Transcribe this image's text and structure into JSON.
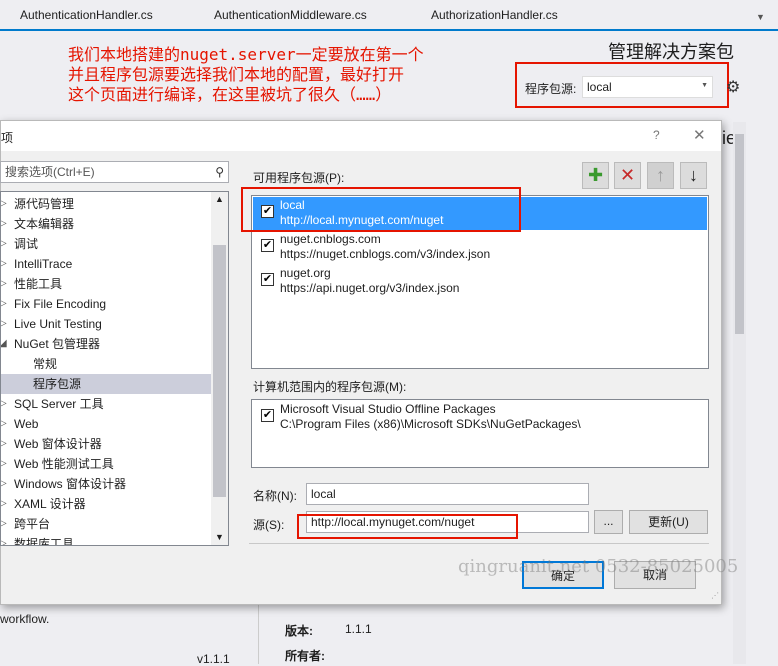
{
  "tabs": [
    "AuthenticationHandler.cs",
    "AuthenticationMiddleware.cs",
    "AuthorizationHandler.cs"
  ],
  "annotation": "我们本地搭建的nuget.server一定要放在第一个\n并且程序包源要选择我们本地的配置，最好打开\n这个页面进行编译，在这里被坑了很久（……）",
  "manager": {
    "title": "管理解决方案包",
    "source_label": "程序包源:",
    "source_value": "local",
    "partial_heading": "ie:"
  },
  "dialog": {
    "title": "项",
    "help": "?",
    "close": "✕",
    "search_placeholder": "搜索选项(Ctrl+E)",
    "tree": [
      {
        "label": "源代码管理",
        "arrow": "▷"
      },
      {
        "label": "文本编辑器",
        "arrow": "▷"
      },
      {
        "label": "调试",
        "arrow": "▷"
      },
      {
        "label": "IntelliTrace",
        "arrow": "▷"
      },
      {
        "label": "性能工具",
        "arrow": "▷"
      },
      {
        "label": "Fix File Encoding",
        "arrow": "▷"
      },
      {
        "label": "Live Unit Testing",
        "arrow": "▷"
      },
      {
        "label": "NuGet 包管理器",
        "arrow": "◢"
      },
      {
        "label": "常规",
        "sub": true
      },
      {
        "label": "程序包源",
        "sub": true,
        "selected": true
      },
      {
        "label": "SQL Server 工具",
        "arrow": "▷"
      },
      {
        "label": "Web",
        "arrow": "▷"
      },
      {
        "label": "Web 窗体设计器",
        "arrow": "▷"
      },
      {
        "label": "Web 性能测试工具",
        "arrow": "▷"
      },
      {
        "label": "Windows 窗体设计器",
        "arrow": "▷"
      },
      {
        "label": "XAML 设计器",
        "arrow": "▷"
      },
      {
        "label": "跨平台",
        "arrow": "▷"
      },
      {
        "label": "数据库工具",
        "arrow": "▷"
      }
    ],
    "available_label": "可用程序包源(P):",
    "sources": [
      {
        "name": "local",
        "url": "http://local.mynuget.com/nuget",
        "checked": true,
        "selected": true
      },
      {
        "name": "nuget.cnblogs.com",
        "url": "https://nuget.cnblogs.com/v3/index.json",
        "checked": true
      },
      {
        "name": "nuget.org",
        "url": "https://api.nuget.org/v3/index.json",
        "checked": true
      }
    ],
    "machine_label": "计算机范围内的程序包源(M):",
    "machine_sources": [
      {
        "name": "Microsoft Visual Studio Offline Packages",
        "url": "C:\\Program Files (x86)\\Microsoft SDKs\\NuGetPackages\\",
        "checked": true
      }
    ],
    "name_label": "名称(N):",
    "name_value": "local",
    "source_label": "源(S):",
    "source_value": "http://local.mynuget.com/nuget",
    "browse": "...",
    "update": "更新(U)",
    "ok": "确定",
    "cancel": "取消"
  },
  "background": {
    "desc_tail": "workflow.",
    "version_label": "版本:",
    "version_value": "1.1.1",
    "owner_label": "所有者:",
    "version_tag": "v1.1.1"
  },
  "watermark": "qingruanit.net 0532-85025005",
  "colors": {
    "annotation": "#e51400",
    "selection": "#3399ff",
    "accent": "#007acc"
  }
}
